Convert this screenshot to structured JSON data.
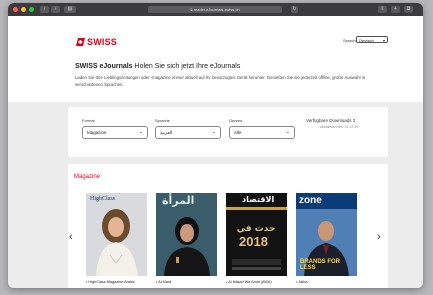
{
  "browser": {
    "url": "reader.eJournals.swiss.ch",
    "close_color": "#ff5f57",
    "minimize_color": "#febc2e",
    "zoom_color": "#28c840"
  },
  "brand": {
    "logo_text": "SWISS",
    "brand_color": "#e2001a"
  },
  "language": {
    "label": "Sprache",
    "value": "Deutsch"
  },
  "intro": {
    "title_bold": "SWISS eJournals",
    "title_rest": "Holen Sie sich jetzt Ihre eJournals",
    "description": "Laden Sie Ihre Lieblingszeitungen oder -magazine immer aktuell auf Ihr bevorzugtes Gerät herunter. Genießen Sie sie jederzeit offline, große Auswahl in verschiedenen Sprachen."
  },
  "filters": [
    {
      "label": "Format",
      "value": "Magazine"
    },
    {
      "label": "Sprache",
      "value": "العربية"
    },
    {
      "label": "Genres",
      "value": "Alle"
    }
  ],
  "downloads": {
    "title": "Verfügbare Downloads 2",
    "updated": "aktualisiert am: 31.12.19"
  },
  "section": {
    "title": "Magazine"
  },
  "magazines": [
    {
      "name": "HighClass Magazine Arabic",
      "masthead": "HighClass"
    },
    {
      "name": "Al Mara",
      "masthead": "المرأة"
    },
    {
      "name": "Al Iktisad Wa Amal (AWA)",
      "masthead": "الاقتصاد",
      "year": "2018"
    },
    {
      "name": "Jaiba",
      "masthead": "zone",
      "tagline": "BRANDS FOR LESS"
    }
  ]
}
